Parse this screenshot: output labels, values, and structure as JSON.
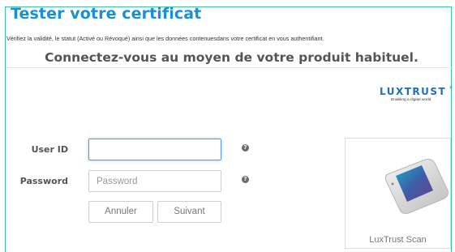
{
  "page": {
    "title": "Tester votre certificat",
    "intro": "Vérifiez la validité, le statut (Activé ou Révoqué) ainsi que les données contenuesdans votre certificat en vous authentifiant.",
    "heading": "Connectez-vous au moyen de votre produit habituel."
  },
  "brand": {
    "name": "LUXTRUST",
    "trademark": "®",
    "tagline": "Enabling a digital world"
  },
  "form": {
    "user_id_label": "User ID",
    "user_id_value": "",
    "user_id_placeholder": "",
    "password_label": "Password",
    "password_value": "",
    "password_placeholder": "Password",
    "help_glyph": "?",
    "cancel_label": "Annuler",
    "next_label": "Suivant"
  },
  "device": {
    "label": "LuxTrust Scan",
    "icon": "luxtrust-scan-device-icon"
  },
  "colors": {
    "title": "#1b8fd0",
    "frame_border": "#3fbfb0",
    "brand": "#1e6fb8",
    "focus_border": "#5b9ad8"
  }
}
